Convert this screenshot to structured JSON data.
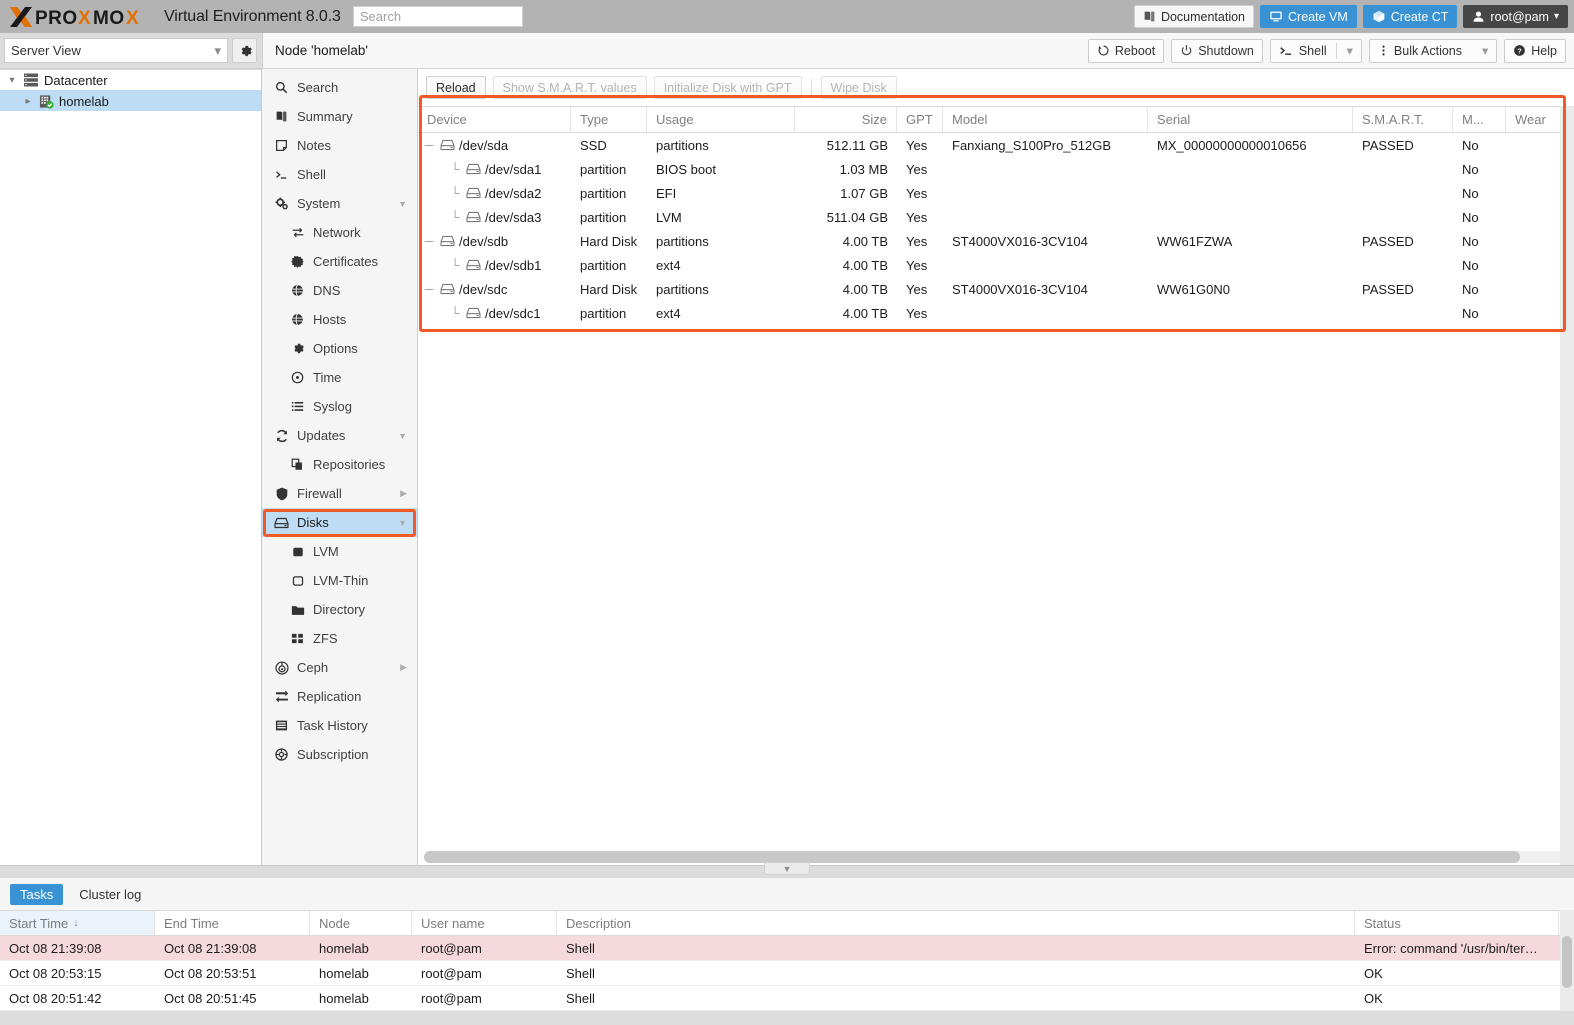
{
  "header": {
    "product": "PROXMOX",
    "product_suffix": "Virtual Environment 8.0.3",
    "search_placeholder": "Search",
    "documentation_label": "Documentation",
    "create_vm_label": "Create VM",
    "create_ct_label": "Create CT",
    "user_label": "root@pam",
    "accent_blue": "#3892d4",
    "brand_orange": "#e57000"
  },
  "serverview": {
    "select_value": "Server View",
    "gear_icon": "gear-icon",
    "tree": [
      {
        "label": "Datacenter",
        "icon": "datacenter-icon",
        "selected": false,
        "indent": false,
        "arrow": "∨"
      },
      {
        "label": "homelab",
        "icon": "node-icon",
        "selected": true,
        "indent": true,
        "arrow": "›"
      }
    ]
  },
  "nodebar": {
    "title": "Node 'homelab'",
    "buttons": [
      {
        "label": "Reboot",
        "icon": "reboot-icon"
      },
      {
        "label": "Shutdown",
        "icon": "power-icon"
      },
      {
        "label": "Shell",
        "icon": "shell-prompt-icon",
        "split": true
      },
      {
        "label": "Bulk Actions",
        "icon": "kebab-icon",
        "split": true
      },
      {
        "label": "Help",
        "icon": "help-icon"
      }
    ]
  },
  "navmenu": {
    "items": [
      {
        "label": "Search",
        "icon": "search-icon",
        "level": 0,
        "selected": false,
        "expander": ""
      },
      {
        "label": "Summary",
        "icon": "book-icon",
        "level": 0,
        "selected": false,
        "expander": ""
      },
      {
        "label": "Notes",
        "icon": "note-icon",
        "level": 0,
        "selected": false,
        "expander": ""
      },
      {
        "label": "Shell",
        "icon": "shell-prompt-icon",
        "level": 0,
        "selected": false,
        "expander": ""
      },
      {
        "label": "System",
        "icon": "gears-icon",
        "level": 0,
        "selected": false,
        "expander": "down"
      },
      {
        "label": "Network",
        "icon": "network-icon",
        "level": 1,
        "selected": false,
        "expander": ""
      },
      {
        "label": "Certificates",
        "icon": "certificate-icon",
        "level": 1,
        "selected": false,
        "expander": ""
      },
      {
        "label": "DNS",
        "icon": "globe-icon",
        "level": 1,
        "selected": false,
        "expander": ""
      },
      {
        "label": "Hosts",
        "icon": "globe-icon",
        "level": 1,
        "selected": false,
        "expander": ""
      },
      {
        "label": "Options",
        "icon": "gear-icon",
        "level": 1,
        "selected": false,
        "expander": ""
      },
      {
        "label": "Time",
        "icon": "clock-icon",
        "level": 1,
        "selected": false,
        "expander": ""
      },
      {
        "label": "Syslog",
        "icon": "list-icon",
        "level": 1,
        "selected": false,
        "expander": ""
      },
      {
        "label": "Updates",
        "icon": "refresh-icon",
        "level": 0,
        "selected": false,
        "expander": "down"
      },
      {
        "label": "Repositories",
        "icon": "repository-icon",
        "level": 1,
        "selected": false,
        "expander": ""
      },
      {
        "label": "Firewall",
        "icon": "shield-icon",
        "level": 0,
        "selected": false,
        "expander": "right"
      },
      {
        "label": "Disks",
        "icon": "disk-icon",
        "level": 0,
        "selected": true,
        "expander": "down"
      },
      {
        "label": "LVM",
        "icon": "lvm-icon",
        "level": 1,
        "selected": false,
        "expander": ""
      },
      {
        "label": "LVM-Thin",
        "icon": "lvm-thin-icon",
        "level": 1,
        "selected": false,
        "expander": ""
      },
      {
        "label": "Directory",
        "icon": "folder-icon",
        "level": 1,
        "selected": false,
        "expander": ""
      },
      {
        "label": "ZFS",
        "icon": "zfs-icon",
        "level": 1,
        "selected": false,
        "expander": ""
      },
      {
        "label": "Ceph",
        "icon": "ceph-icon",
        "level": 0,
        "selected": false,
        "expander": "right"
      },
      {
        "label": "Replication",
        "icon": "replication-icon",
        "level": 0,
        "selected": false,
        "expander": ""
      },
      {
        "label": "Task History",
        "icon": "tasklog-icon",
        "level": 0,
        "selected": false,
        "expander": ""
      },
      {
        "label": "Subscription",
        "icon": "subscription-icon",
        "level": 0,
        "selected": false,
        "expander": ""
      }
    ]
  },
  "disks": {
    "toolbar": [
      {
        "label": "Reload",
        "disabled": false
      },
      {
        "label": "Show S.M.A.R.T. values",
        "disabled": true
      },
      {
        "label": "Initialize Disk with GPT",
        "disabled": true
      },
      {
        "label": "Wipe Disk",
        "disabled": true
      }
    ],
    "columns": [
      "Device",
      "Type",
      "Usage",
      "Size",
      "GPT",
      "Model",
      "Serial",
      "S.M.A.R.T.",
      "M...",
      "Wear"
    ],
    "rows": [
      {
        "device": "/dev/sda",
        "child": false,
        "type": "SSD",
        "usage": "partitions",
        "size": "512.11 GB",
        "gpt": "Yes",
        "model": "Fanxiang_S100Pro_512GB",
        "serial": "MX_00000000000010656",
        "smart": "PASSED",
        "m": "No",
        "wear": ""
      },
      {
        "device": "/dev/sda1",
        "child": true,
        "type": "partition",
        "usage": "BIOS boot",
        "size": "1.03 MB",
        "gpt": "Yes",
        "model": "",
        "serial": "",
        "smart": "",
        "m": "No",
        "wear": ""
      },
      {
        "device": "/dev/sda2",
        "child": true,
        "type": "partition",
        "usage": "EFI",
        "size": "1.07 GB",
        "gpt": "Yes",
        "model": "",
        "serial": "",
        "smart": "",
        "m": "No",
        "wear": ""
      },
      {
        "device": "/dev/sda3",
        "child": true,
        "type": "partition",
        "usage": "LVM",
        "size": "511.04 GB",
        "gpt": "Yes",
        "model": "",
        "serial": "",
        "smart": "",
        "m": "No",
        "wear": ""
      },
      {
        "device": "/dev/sdb",
        "child": false,
        "type": "Hard Disk",
        "usage": "partitions",
        "size": "4.00 TB",
        "gpt": "Yes",
        "model": "ST4000VX016-3CV104",
        "serial": "WW61FZWA",
        "smart": "PASSED",
        "m": "No",
        "wear": ""
      },
      {
        "device": "/dev/sdb1",
        "child": true,
        "type": "partition",
        "usage": "ext4",
        "size": "4.00 TB",
        "gpt": "Yes",
        "model": "",
        "serial": "",
        "smart": "",
        "m": "No",
        "wear": ""
      },
      {
        "device": "/dev/sdc",
        "child": false,
        "type": "Hard Disk",
        "usage": "partitions",
        "size": "4.00 TB",
        "gpt": "Yes",
        "model": "ST4000VX016-3CV104",
        "serial": "WW61G0N0",
        "smart": "PASSED",
        "m": "No",
        "wear": ""
      },
      {
        "device": "/dev/sdc1",
        "child": true,
        "type": "partition",
        "usage": "ext4",
        "size": "4.00 TB",
        "gpt": "Yes",
        "model": "",
        "serial": "",
        "smart": "",
        "m": "No",
        "wear": ""
      }
    ]
  },
  "bottom": {
    "tabs": [
      {
        "label": "Tasks",
        "active": true
      },
      {
        "label": "Cluster log",
        "active": false
      }
    ],
    "columns": [
      "Start Time",
      "End Time",
      "Node",
      "User name",
      "Description",
      "Status"
    ],
    "sort_column": "Start Time",
    "sort_direction": "↓",
    "rows": [
      {
        "start": "Oct 08 21:39:08",
        "end": "Oct 08 21:39:08",
        "node": "homelab",
        "user": "root@pam",
        "description": "Shell",
        "status": "Error: command '/usr/bin/ter…",
        "error": true
      },
      {
        "start": "Oct 08 20:53:15",
        "end": "Oct 08 20:53:51",
        "node": "homelab",
        "user": "root@pam",
        "description": "Shell",
        "status": "OK",
        "error": false
      },
      {
        "start": "Oct 08 20:51:42",
        "end": "Oct 08 20:51:45",
        "node": "homelab",
        "user": "root@pam",
        "description": "Shell",
        "status": "OK",
        "error": false
      }
    ]
  },
  "annotations": {
    "color": "#f05a28",
    "boxes": [
      "disks-table-highlight",
      "disks-menu-highlight"
    ]
  }
}
